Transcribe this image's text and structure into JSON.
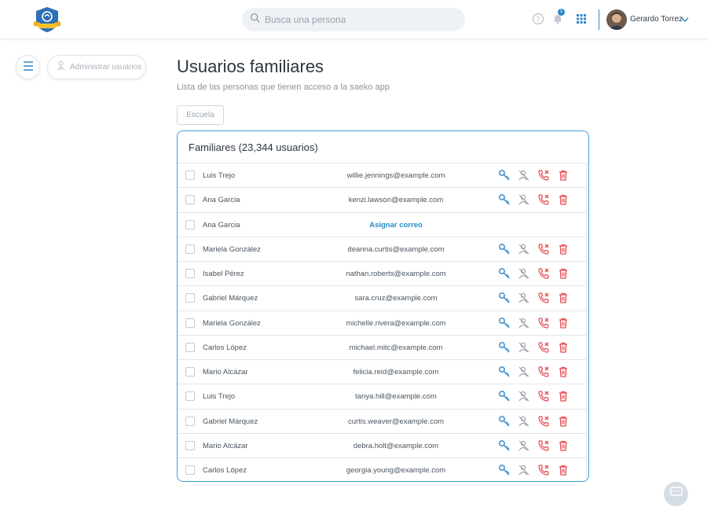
{
  "header": {
    "search_placeholder": "Busca una persona",
    "notifications_count": "1",
    "user_name": "Gerardo Torrez"
  },
  "nav": {
    "admin_label": "Administrar usuarios"
  },
  "page": {
    "title": "Usuarios familiares",
    "subtitle": "Lista de las personas que tienen acceso a la saeko app",
    "filter_label": "Escuela"
  },
  "card": {
    "title": "Familiares (23,344 usuarios)"
  },
  "rows": [
    {
      "name": "Luis Trejo",
      "email": "willie.jennings@example.com"
    },
    {
      "name": "Ana Garcia",
      "email": "kenzi.lawson@example.com"
    },
    {
      "name": "Ana Garcia",
      "email": "Asignar correo"
    },
    {
      "name": "Mariela González",
      "email": "deanna.curtis@example.com"
    },
    {
      "name": "Isabel Pérez",
      "email": "nathan.roberts@example.com"
    },
    {
      "name": "Gabriel Márquez",
      "email": "sara.cruz@example.com"
    },
    {
      "name": "Mariela González",
      "email": "michelle.rivera@example.com"
    },
    {
      "name": "Carlos López",
      "email": "michael.mitc@example.com"
    },
    {
      "name": "Mario Alcázar",
      "email": "felicia.reid@example.com"
    },
    {
      "name": "Luis Trejo",
      "email": "tanya.hill@example.com"
    },
    {
      "name": "Gabriel Márquez",
      "email": "curtis.weaver@example.com"
    },
    {
      "name": "Mario Alcázar",
      "email": "debra.holt@example.com"
    },
    {
      "name": "Carlos López",
      "email": "georgia.young@example.com"
    }
  ],
  "icons": {
    "row_actions": [
      "key-icon",
      "remove-user-icon",
      "phone-off-icon",
      "trash-icon"
    ],
    "header": [
      "search-icon",
      "help-icon",
      "bell-icon",
      "apps-grid-icon",
      "chevron-down-icon"
    ]
  },
  "colors": {
    "accent": "#2e86c9",
    "danger": "#e5484d",
    "link": "#1f8bc7"
  }
}
